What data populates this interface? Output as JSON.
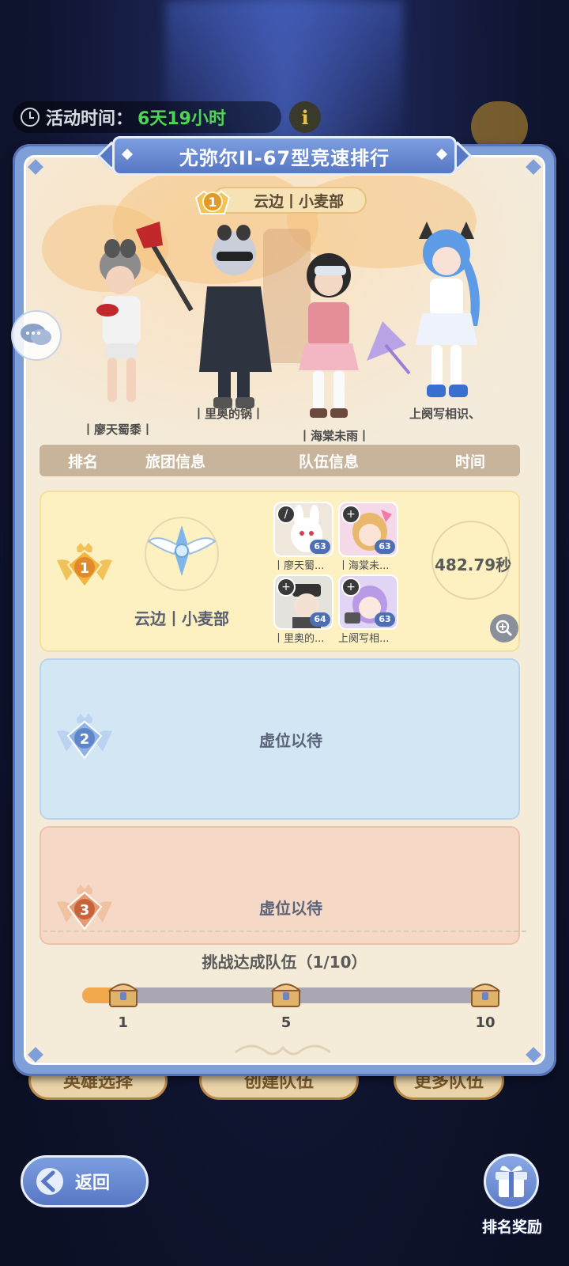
{
  "activity": {
    "label": "活动时间：",
    "value": "6天19小时",
    "info_glyph": "i"
  },
  "background_buttons": {
    "hero_select": "英雄选择",
    "create_team": "创建队伍",
    "more_teams": "更多队伍"
  },
  "panel": {
    "title": "尤弥尔II-67型竞速排行",
    "champion_tag": "云边丨小麦部",
    "champion_rank": "1",
    "characters": [
      {
        "name": "丨廖天蜀黍丨"
      },
      {
        "name": "丨里奥的锅丨"
      },
      {
        "name": "丨海棠未雨丨"
      },
      {
        "name": "上阕写相识、"
      }
    ]
  },
  "table": {
    "headers": {
      "rank": "排名",
      "guild": "旅团信息",
      "team": "队伍信息",
      "time": "时间"
    },
    "rows": [
      {
        "rank": "1",
        "guild_name": "云边丨小麦部",
        "members": [
          {
            "name": "丨廖天蜀...",
            "level": "63"
          },
          {
            "name": "丨海棠未...",
            "level": "63"
          },
          {
            "name": "丨里奥的...",
            "level": "64"
          },
          {
            "name": "上阕写相...",
            "level": "63"
          }
        ],
        "time": "482.79秒"
      },
      {
        "rank": "2",
        "vacant": "虚位以待"
      },
      {
        "rank": "3",
        "vacant": "虚位以待"
      }
    ]
  },
  "progress": {
    "title": "挑战达成队伍（1/10）",
    "current": 1,
    "max": 10,
    "milestones": [
      "1",
      "5",
      "10"
    ]
  },
  "controls": {
    "back_label": "返回",
    "rank_reward_label": "排名奖励"
  },
  "colors": {
    "accent_blue": "#5877c4",
    "gold": "#e8b44a",
    "time_green": "#4ed456",
    "progress_orange": "#f2a84c"
  }
}
